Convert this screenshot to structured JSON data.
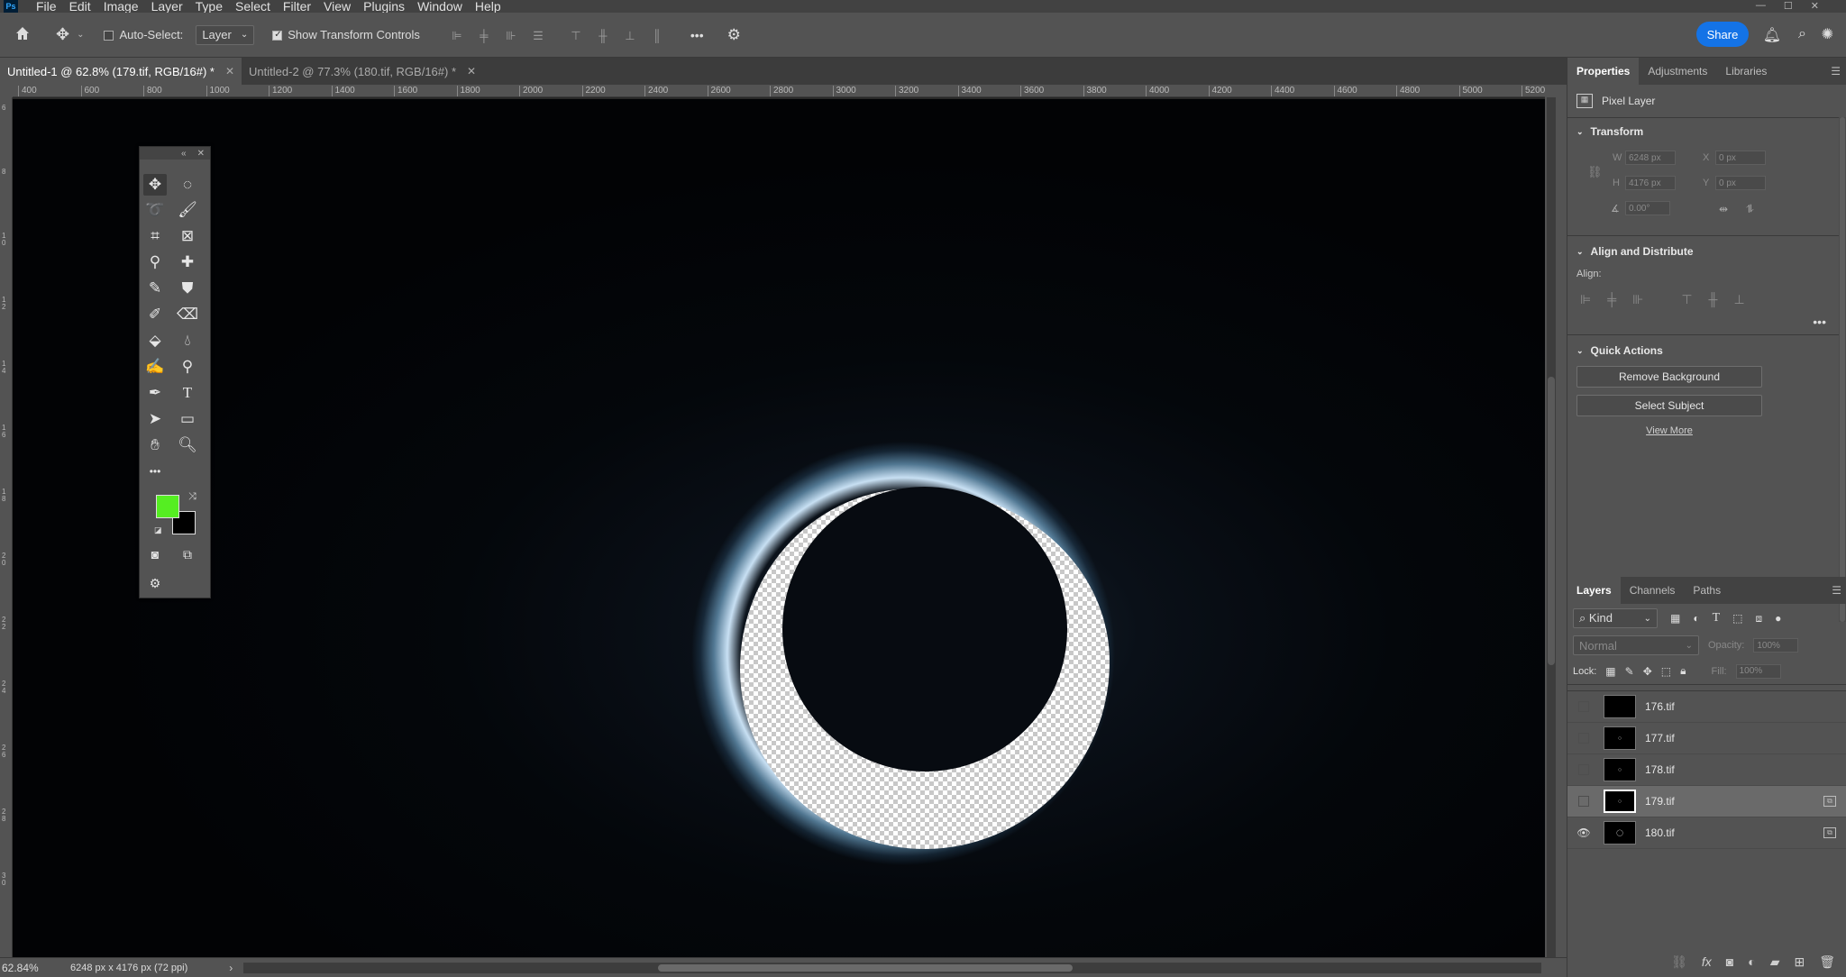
{
  "app": {
    "logo": "Ps"
  },
  "menu": [
    "File",
    "Edit",
    "Image",
    "Layer",
    "Type",
    "Select",
    "Filter",
    "View",
    "Plugins",
    "Window",
    "Help"
  ],
  "options": {
    "auto_select_label": "Auto-Select:",
    "auto_select_value": "Layer",
    "show_transform_label": "Show Transform Controls",
    "more": "•••",
    "share": "Share"
  },
  "tabs": [
    {
      "label": "Untitled-1 @ 62.8% (179.tif, RGB/16#) *",
      "active": true
    },
    {
      "label": "Untitled-2 @ 77.3% (180.tif, RGB/16#) *",
      "active": false
    }
  ],
  "ruler_top": [
    "400",
    "600",
    "800",
    "1000",
    "1200",
    "1400",
    "1600",
    "1800",
    "2000",
    "2200",
    "2400",
    "2600",
    "2800",
    "3000",
    "3200",
    "3400",
    "3600",
    "3800",
    "4000",
    "4200",
    "4400",
    "4600",
    "4800",
    "5000",
    "5200"
  ],
  "ruler_left": [
    "6",
    "8",
    "1 0",
    "1 2",
    "1 4",
    "1 6",
    "1 8",
    "2 0",
    "2 2",
    "2 4",
    "2 6",
    "2 8",
    "3 0"
  ],
  "toolbox": {
    "more": "•••"
  },
  "properties": {
    "tabs": [
      "Properties",
      "Adjustments",
      "Libraries"
    ],
    "layer_type": "Pixel Layer",
    "transform_title": "Transform",
    "w_label": "W",
    "w_value": "6248 px",
    "h_label": "H",
    "h_value": "4176 px",
    "x_label": "X",
    "x_value": "0 px",
    "y_label": "Y",
    "y_value": "0 px",
    "angle_value": "0.00°",
    "align_title": "Align and Distribute",
    "align_label": "Align:",
    "quick_title": "Quick Actions",
    "remove_bg": "Remove Background",
    "select_subject": "Select Subject",
    "view_more": "View More"
  },
  "layers_panel": {
    "tabs": [
      "Layers",
      "Channels",
      "Paths"
    ],
    "filter_kind": "Kind",
    "blend_mode": "Normal",
    "opacity_label": "Opacity:",
    "opacity_value": "100%",
    "lock_label": "Lock:",
    "fill_label": "Fill:",
    "fill_value": "100%",
    "layers": [
      {
        "name": "176.tif",
        "visible": false,
        "selected": false
      },
      {
        "name": "177.tif",
        "visible": false,
        "selected": false
      },
      {
        "name": "178.tif",
        "visible": false,
        "selected": false
      },
      {
        "name": "179.tif",
        "visible": false,
        "selected": true
      },
      {
        "name": "180.tif",
        "visible": true,
        "selected": false
      }
    ]
  },
  "status": {
    "zoom": "62.84%",
    "doc_info": "6248 px x 4176 px (72 ppi)"
  }
}
